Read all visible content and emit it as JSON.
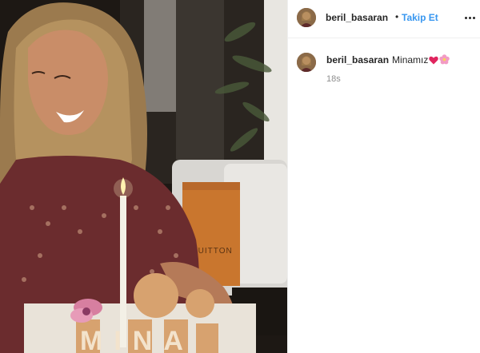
{
  "post": {
    "username": "beril_basaran",
    "separator": "•",
    "follow_label": "Takip Et",
    "more_icon": "more-horizontal-icon"
  },
  "caption": {
    "username": "beril_basaran",
    "text": "Minamız",
    "emojis": [
      "red-heart-emoji",
      "pink-flower-emoji"
    ],
    "time": "18s"
  },
  "photo": {
    "bag_text": "VUITTON",
    "cake_text": "MINA"
  },
  "colors": {
    "link": "#3897f0",
    "text": "#262626",
    "muted": "#8e8e8e",
    "divider": "#efefef"
  }
}
